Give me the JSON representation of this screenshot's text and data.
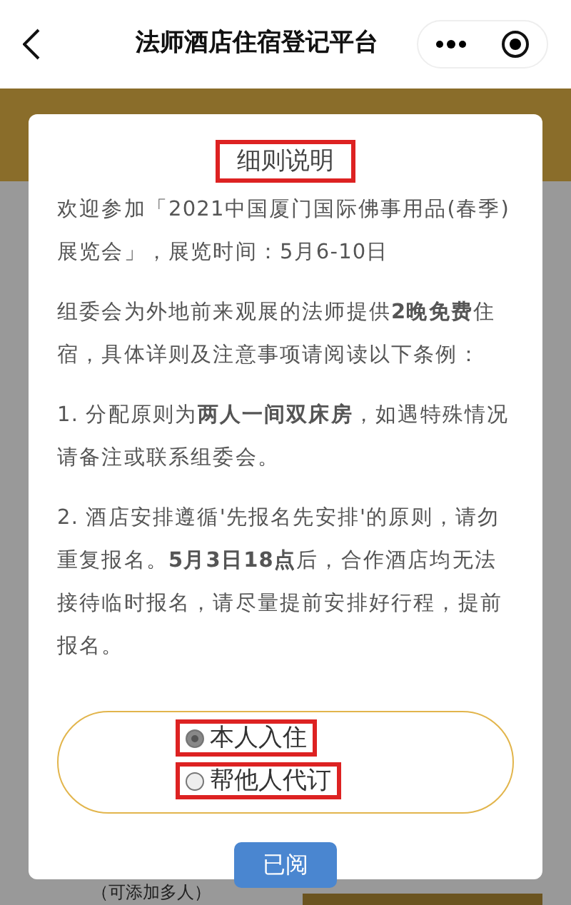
{
  "header": {
    "title": "法师酒店住宿登记平台"
  },
  "background": {
    "note": "（可添加多人）"
  },
  "dialog": {
    "title": "细则说明",
    "paragraphs": [
      "欢迎参加「2021中国厦门国际佛事用品(春季)展览会」，展览时间：5月6-10日",
      "组委会为外地前来观展的法师提供**2晚免费**住宿，具体详则及注意事项请阅读以下条例：",
      "1. 分配原则为**两人一间双床房**，如遇特殊情况请备注或联系组委会。",
      "2. 酒店安排遵循'先报名先安排'的原则，请勿重复报名。**5月3日18点**后，合作酒店均无法接待临时报名，请尽量提前安排好行程，提前报名。"
    ],
    "options": [
      {
        "label": "本人入住",
        "selected": true
      },
      {
        "label": "帮他人代订",
        "selected": false
      }
    ],
    "button": "已阅"
  }
}
